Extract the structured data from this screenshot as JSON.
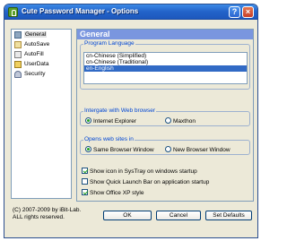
{
  "window": {
    "title": "Cute Password Manager - Options",
    "help_label": "?",
    "close_label": "×"
  },
  "sidebar": {
    "items": [
      {
        "label": "General",
        "icon": "general-icon",
        "selected": true
      },
      {
        "label": "AutoSave",
        "icon": "autosave-icon"
      },
      {
        "label": "AutoFill",
        "icon": "autofill-icon"
      },
      {
        "label": "UserData",
        "icon": "userdata-icon"
      },
      {
        "label": "Security",
        "icon": "security-icon"
      }
    ]
  },
  "general": {
    "header": "General",
    "program_language": {
      "legend": "Program Language",
      "options": [
        "cn-Chinese (Simplified)",
        "cn-Chinese (Traditional)",
        "en-English"
      ],
      "selected": "en-English"
    },
    "web_browser": {
      "legend": "Intergate with Web browser",
      "option1": "Internet Explorer",
      "option2": "Maxthon",
      "selected": "Internet Explorer"
    },
    "opens_web_sites": {
      "legend": "Opens web sites in",
      "option1": "Same Browser Window",
      "option2": "New Browser Window",
      "selected": "Same Browser Window"
    },
    "checkboxes": [
      {
        "label": "Show icon in SysTray on windows startup",
        "checked": true
      },
      {
        "label": "Show Quick Launch Bar on application startup",
        "checked": false
      },
      {
        "label": "Show Office XP style",
        "checked": true
      }
    ]
  },
  "footer": {
    "copyright_line1": "(C) 2007-2009 by iBit-Lab.",
    "copyright_line2": "ALL rights reserved.",
    "ok_label": "OK",
    "cancel_label": "Cancel",
    "set_defaults_label": "Set Defaults"
  },
  "colors": {
    "titlebar": "#2363c9",
    "header": "#7a96df",
    "selection": "#316ac5",
    "radio_check": "#21a121"
  }
}
